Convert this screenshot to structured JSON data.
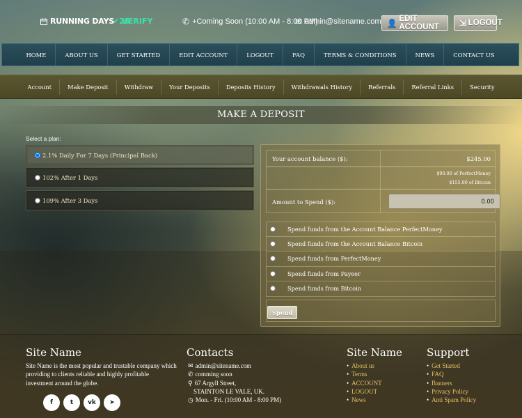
{
  "topbar": {
    "running_days_label": "RUNNING DAYS",
    "running_days_value": "25",
    "verify_label": "VERIFY",
    "phone_text": "+Coming Soon (10:00 AM - 8:00 PM)",
    "email_text": "admin@sitename.com",
    "edit_account_label": "EDIT ACCOUNT",
    "logout_label": "LOGOUT"
  },
  "main_nav": [
    "HOME",
    "ABOUT US",
    "GET STARTED",
    "EDIT ACCOUNT",
    "LOGOUT",
    "FAQ",
    "TERMS & CONDITIONS",
    "NEWS",
    "CONTACT US"
  ],
  "account_nav": [
    "Account",
    "Make Deposit",
    "Withdraw",
    "Your Deposits",
    "Deposits History",
    "Withdrawals History",
    "Referrals",
    "Referral Links",
    "Security"
  ],
  "page_title": "MAKE A DEPOSIT",
  "plans": {
    "label": "Select a plan:",
    "options": [
      "2.1% Daily For 7 Days (Principal Back)",
      "102% After 1 Days",
      "109% After 3 Days"
    ],
    "selected_index": 0
  },
  "deposit": {
    "balance_label": "Your account balance ($):",
    "balance_value": "$245.00",
    "perfectmoney_balance": "$90.00 of PerfectMoney",
    "bitcoin_balance": "$155.00 of Bitcoin",
    "amount_label": "Amount to Spend ($):",
    "amount_value": "0.00",
    "spend_options": [
      "Spend funds from the Account Balance PerfectMoney",
      "Spend funds from the Account Balance Bitcoin",
      "Spend funds from PerfectMoney",
      "Spend funds from Payeer",
      "Spend funds from Bitcoin"
    ],
    "spend_button": "Spend"
  },
  "footer": {
    "about_title": "Site Name",
    "about_text": "Site Name is the most popular and trustable company which providing to clients reliable and highly profitable investment around the globe.",
    "contacts_title": "Contacts",
    "contact_email": "admin@sitename.com",
    "contact_phone": "comming soon",
    "contact_address1": "67 Argyll Street,",
    "contact_address2": "STAINTON LE VALE, UK.",
    "contact_hours": "Mon. - Fri. (10:00 AM - 8:00 PM)",
    "links_title": "Site Name",
    "links": [
      "About us",
      "Terms",
      "ACCOUNT",
      "LOGOUT",
      "News"
    ],
    "support_title": "Support",
    "support_links": [
      "Get Started",
      "FAQ",
      "Banners",
      "Privacy Policy",
      "Anti Spam Policy"
    ],
    "social_icons": [
      "facebook-icon",
      "twitter-icon",
      "vk-icon",
      "telegram-icon"
    ]
  }
}
